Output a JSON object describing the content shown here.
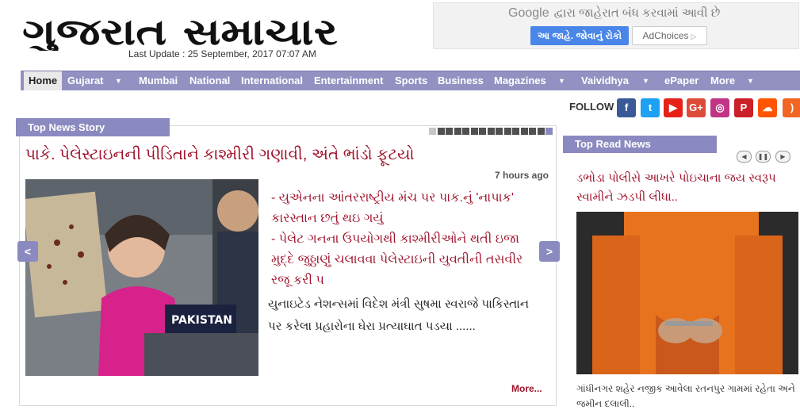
{
  "header": {
    "logo_text": "ગુજરાત સમાચાર",
    "last_update": "Last Update : 25 September, 2017 07:07 AM"
  },
  "ad": {
    "brand": "Google",
    "message": "દ્વારા જાહેરાત બંધ કરવામાં આવી છે",
    "button_primary": "આ જાહે. જોવાનું રોકો",
    "button_secondary": "AdChoices",
    "button_secondary_icon": "adchoices-icon"
  },
  "nav": {
    "items": [
      {
        "label": "Home",
        "dropdown": false,
        "active": true
      },
      {
        "label": "Gujarat",
        "dropdown": true
      },
      {
        "label": "Mumbai",
        "dropdown": false
      },
      {
        "label": "National",
        "dropdown": false
      },
      {
        "label": "International",
        "dropdown": false
      },
      {
        "label": "Entertainment",
        "dropdown": false
      },
      {
        "label": "Sports",
        "dropdown": false
      },
      {
        "label": "Business",
        "dropdown": false
      },
      {
        "label": "Magazines",
        "dropdown": true
      },
      {
        "label": "Vaividhya",
        "dropdown": true
      },
      {
        "label": "ePaper",
        "dropdown": false
      },
      {
        "label": "More",
        "dropdown": true
      }
    ],
    "caret_glyph": "▼"
  },
  "follow": {
    "label": "FOLLOW",
    "networks": [
      {
        "name": "facebook-icon",
        "glyph": "f",
        "color": "#3b5998"
      },
      {
        "name": "twitter-icon",
        "glyph": "t",
        "color": "#1da1f2"
      },
      {
        "name": "youtube-icon",
        "glyph": "▶",
        "color": "#e62117"
      },
      {
        "name": "google-plus-icon",
        "glyph": "G+",
        "color": "#dd4b39"
      },
      {
        "name": "instagram-icon",
        "glyph": "◎",
        "color": "#c13584"
      },
      {
        "name": "pinterest-icon",
        "glyph": "P",
        "color": "#cb2027"
      },
      {
        "name": "soundcloud-icon",
        "glyph": "☁",
        "color": "#ff5500"
      },
      {
        "name": "rss-icon",
        "glyph": ")",
        "color": "#f26522"
      }
    ]
  },
  "top_news": {
    "section_label": "Top News Story",
    "headline": "પાકે. પેલેસ્ટાઇનની પીડિતાને કાશ્મીરી ગણાવી, અંતે ભાંડો ફૂટયો",
    "time_ago": "7 hours ago",
    "bullets": [
      "- યુએનના આંતરરાષ્ટ્રીય મંચ પર પાક.નું 'નાપાક' કારસ્તાન છતું થઇ ગયું",
      "- પેલેટ ગનના ઉપયોગથી કાશ્મીરીઓને થતી ઇજા મુદ્દે જુઠ્ઠાણું ચલાવવા પેલેસ્ટાઇની યુવતીની તસવીર રજૂ કરી પ"
    ],
    "body": "યુનાઇટેડ નેશન્સમાં વિદેશ મંત્રી સુષમા સ્વરાજે પાકિસ્તાન પર કરેલા પ્રહારોના ઘેરા પ્રત્યાઘાત પડયા ......",
    "more_label": "More...",
    "image_placard_text": "PAKISTAN",
    "slider_dot_count": 15,
    "prev_glyph": "<",
    "next_glyph": ">"
  },
  "top_read": {
    "section_label": "Top Read News",
    "controls": [
      "◀",
      "❚❚",
      "▶"
    ],
    "headline": "ડભોડા પોલીસે આખરે પોઇચાના જય સ્વરૂપ સ્વામીને ઝડપી લીધા..",
    "summary": "ગાંધીનગર શહેર નજીક આવેલા રતનપુર ગામમાં રહેતા અને જમીન દલાલી.."
  },
  "colors": {
    "nav_purple": "#9391c2",
    "label_purple": "#8b8ac0",
    "headline_red": "#a0132c"
  }
}
